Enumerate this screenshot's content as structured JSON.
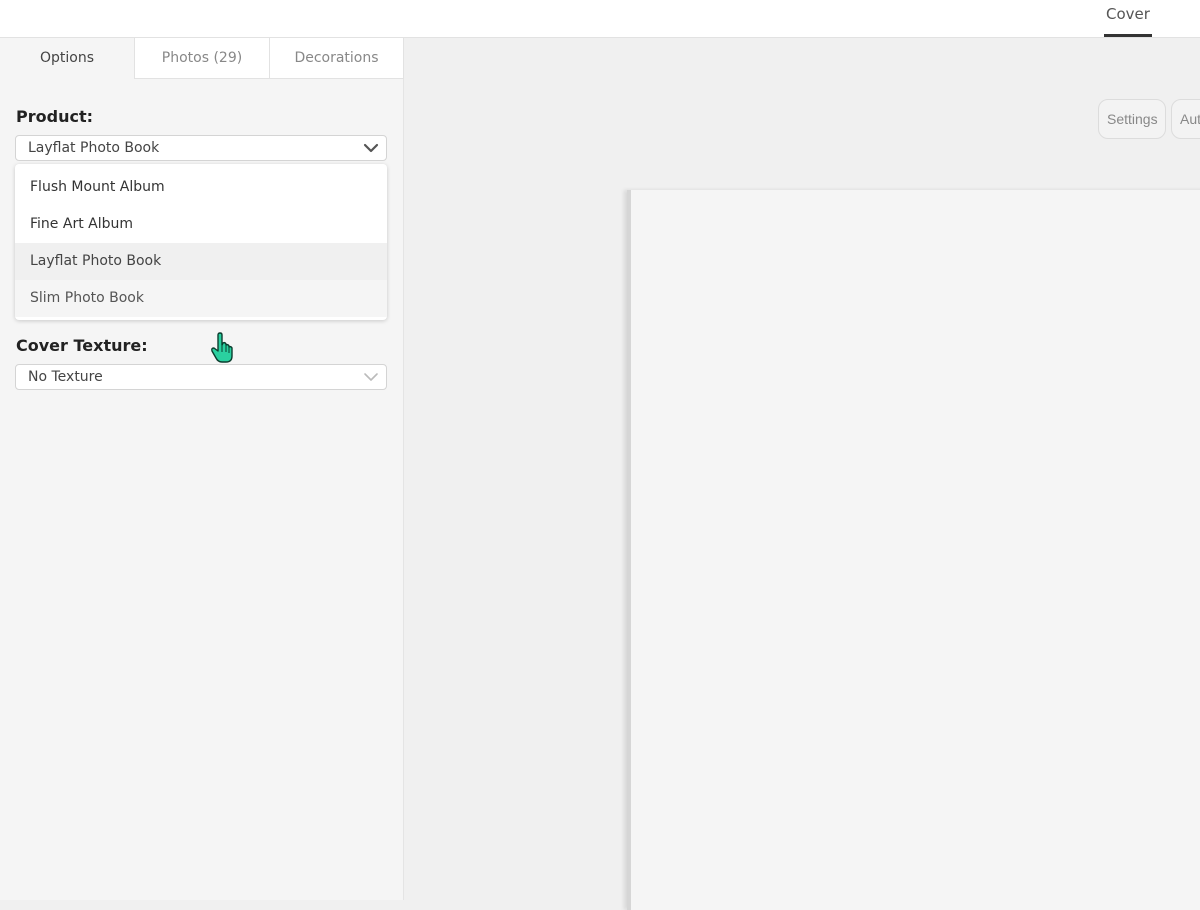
{
  "header": {
    "tabs": [
      {
        "label": "Cover",
        "active": true
      }
    ]
  },
  "sidebar": {
    "tabs": [
      {
        "label": "Options",
        "active": true
      },
      {
        "label": "Photos (29)",
        "active": false
      },
      {
        "label": "Decorations",
        "active": false
      }
    ],
    "product": {
      "label": "Product:",
      "value": "Layflat Photo Book",
      "icon": "chevron-down-icon",
      "dropdown_open": true,
      "options": [
        {
          "label": "Flush Mount Album",
          "state": "normal"
        },
        {
          "label": "Fine Art Album",
          "state": "normal"
        },
        {
          "label": "Layflat Photo Book",
          "state": "selected"
        },
        {
          "label": "Slim Photo Book",
          "state": "hovered"
        }
      ]
    },
    "cover_texture": {
      "label": "Cover Texture:",
      "value": "No Texture",
      "icon": "chevron-down-icon"
    }
  },
  "canvas": {
    "toolbar": {
      "settings_label": "Settings",
      "auto_label": "Aut"
    }
  },
  "cursor": {
    "icon": "hand-pointer-icon",
    "color": "#2ad0a0"
  }
}
